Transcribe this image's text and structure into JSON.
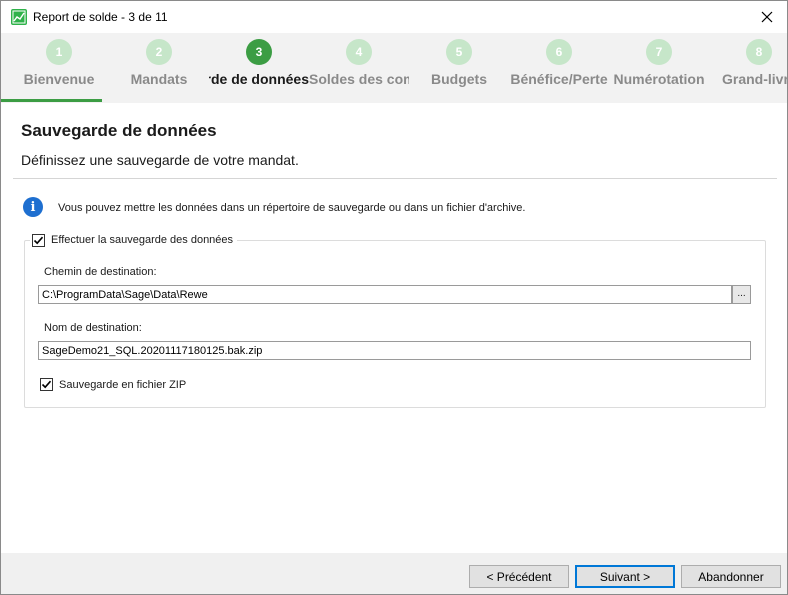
{
  "window": {
    "title": "Report de solde - 3 de 11"
  },
  "steps": [
    {
      "number": "1",
      "label": "Bienvenue"
    },
    {
      "number": "2",
      "label": "Mandats"
    },
    {
      "number": "3",
      "label": "Sauvegarde de données"
    },
    {
      "number": "4",
      "label": "Soldes des comptes"
    },
    {
      "number": "5",
      "label": "Budgets"
    },
    {
      "number": "6",
      "label": "Bénéfice/Perte"
    },
    {
      "number": "7",
      "label": "Numérotation"
    },
    {
      "number": "8",
      "label": "Grand-livre"
    }
  ],
  "active_step": 3,
  "page": {
    "title": "Sauvegarde de données",
    "subtitle": "Définissez une sauvegarde de votre mandat.",
    "info_text": "Vous pouvez mettre les données dans un répertoire de sauvegarde ou dans un fichier d'archive."
  },
  "backup": {
    "enable_label": "Effectuer la sauvegarde des données",
    "enable_checked": true,
    "path_label": "Chemin de destination:",
    "path_value": "C:\\ProgramData\\Sage\\Data\\Rewe",
    "browse_label": "...",
    "name_label": "Nom de destination:",
    "name_value": "SageDemo21_SQL.20201117180125.bak.zip",
    "zip_label": "Sauvegarde en fichier ZIP",
    "zip_checked": true
  },
  "footer": {
    "previous_label": "< Précédent",
    "next_label": "Suivant >",
    "cancel_label": "Abandonner"
  },
  "colors": {
    "accent": "#3c9d44",
    "step_inactive": "#c6e6c9",
    "info": "#1e6fd0",
    "focus": "#0078d7"
  },
  "icons": {
    "app": "chart-trend-icon",
    "close": "close-icon",
    "info": "info-icon",
    "check": "checkmark-icon"
  }
}
